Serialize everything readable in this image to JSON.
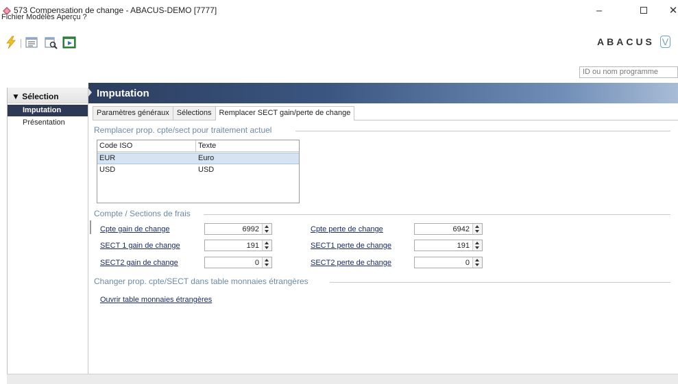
{
  "window": {
    "title": "573 Compensation de change - ABACUS-DEMO [7777]",
    "minimize": "–",
    "close": "✕"
  },
  "menu": [
    "Fichier",
    "Modèles",
    "Aperçu",
    "?"
  ],
  "toolbar": {
    "logo_text": "ABACUS",
    "logo_suffix": "V",
    "program_search_placeholder": "ID ou nom programme"
  },
  "sidebar": {
    "header": "▼ Sélection",
    "items": [
      {
        "label": "Imputation",
        "active": true
      },
      {
        "label": "Présentation",
        "active": false
      }
    ]
  },
  "main": {
    "title": "Imputation",
    "tabs": [
      {
        "label": "Paramètres généraux",
        "active": false
      },
      {
        "label": "Sélections",
        "active": false
      },
      {
        "label": "Remplacer SECT gain/perte de change",
        "active": true
      }
    ]
  },
  "group1": {
    "title": "Remplacer prop. cpte/sect pour traitement actuel",
    "table": {
      "columns": [
        "Code ISO",
        "Texte"
      ],
      "rows": [
        {
          "code": "EUR",
          "text": "Euro",
          "selected": true
        },
        {
          "code": "USD",
          "text": "USD",
          "selected": false
        }
      ]
    }
  },
  "group2": {
    "title": "Compte / Sections de frais",
    "fields": {
      "cpte_gain_label": "Cpte gain de change",
      "cpte_gain_value": "6992",
      "cpte_perte_label": "Cpte perte de change",
      "cpte_perte_value": "6942",
      "sect1_gain_label": "SECT 1 gain de change",
      "sect1_gain_value": "191",
      "sect1_perte_label": "SECT1 perte de change",
      "sect1_perte_value": "191",
      "sect2_gain_label": "SECT2 gain de change",
      "sect2_gain_value": "0",
      "sect2_perte_label": "SECT2 perte de change",
      "sect2_perte_value": "0"
    }
  },
  "group3": {
    "title": "Changer prop. cpte/SECT dans table monnaies étrangères",
    "link": "Ouvrir table monnaies étrangères"
  },
  "colors": {
    "header_dark": "#2c3d5e",
    "selection_bg": "#d5e3f2",
    "link": "#1a2a66",
    "group_title": "#6d8aa6"
  }
}
